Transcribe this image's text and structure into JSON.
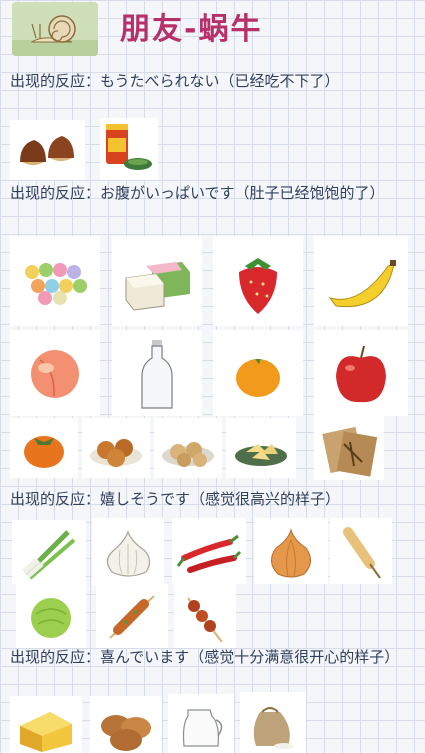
{
  "page": {
    "title": "朋友-蜗牛"
  },
  "sections": [
    {
      "caption": "出现的反应：もうたべられない（已经吃不下了）"
    },
    {
      "caption": "出现的反应：お腹がいっぱいです（肚子已经饱饱的了）"
    },
    {
      "caption": "出现的反应：嬉しそうです（感觉很高兴的样子）"
    },
    {
      "caption": "出现的反应：喜んでいます（感觉十分满意很开心的样子）"
    }
  ],
  "icons": {
    "s1": [
      "chestnuts-icon",
      "tea-tin-icon"
    ],
    "s2": [
      "dango-icon",
      "mochi-icon",
      "strawberry-icon",
      "banana-icon",
      "peach-icon",
      "glass-bottle-icon",
      "mandarin-icon",
      "apple-icon",
      "persimmon-icon",
      "crackers-icon",
      "cookies-icon",
      "rice-crackers-icon",
      "herbs-icon"
    ],
    "s3": [
      "green-onion-icon",
      "garlic-icon",
      "chili-pepper-icon",
      "onion-icon",
      "corn-dog-icon",
      "cabbage-icon",
      "grilled-skewer-icon",
      "yakitori-icon"
    ],
    "s4": [
      "cheese-icon",
      "bread-rolls-icon",
      "milk-jug-icon",
      "flour-sack-icon"
    ]
  }
}
